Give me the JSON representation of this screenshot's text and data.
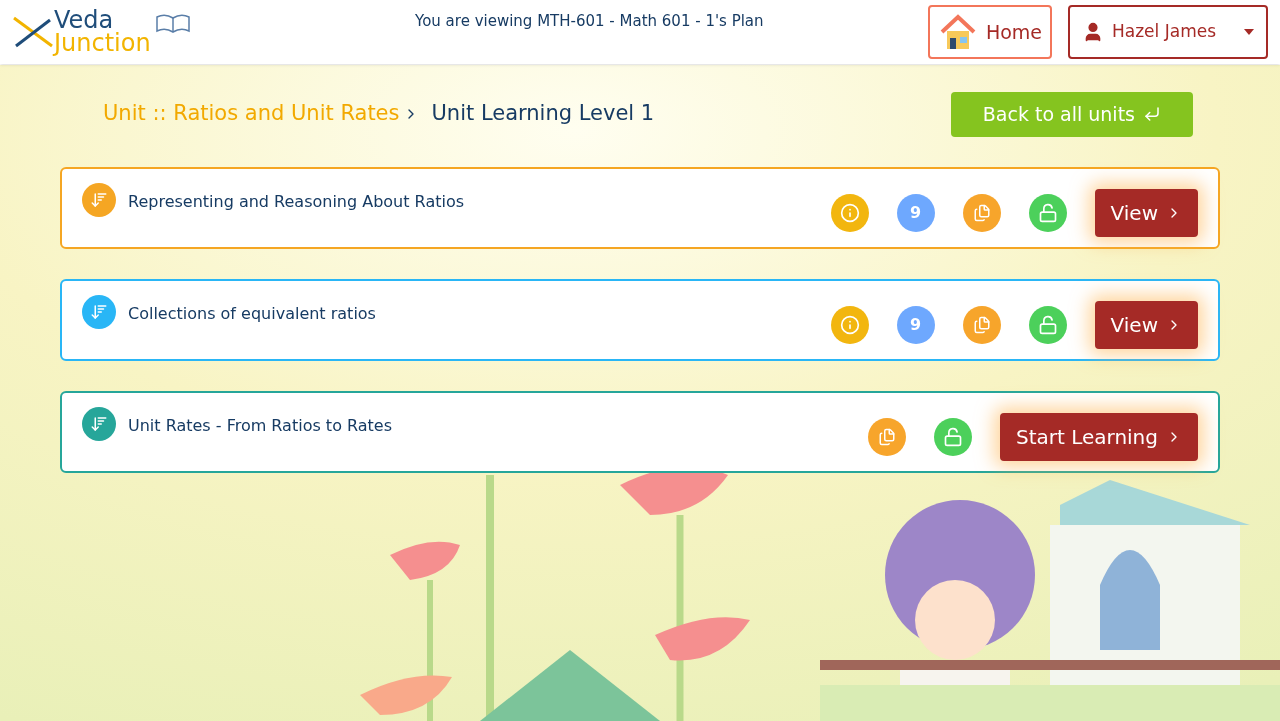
{
  "header": {
    "logo": {
      "line_1": "Veda",
      "line_2": "Junction"
    },
    "viewing_text": "You are viewing MTH-601 - Math 601 - 1's Plan",
    "home_button": "Home",
    "user_menu": "Hazel James"
  },
  "breadcrumb": {
    "unit": "Unit :: Ratios and Unit Rates",
    "current": "Unit Learning Level 1"
  },
  "back_button": "Back to all units",
  "units": [
    {
      "title": "Representing and Reasoning About Ratios",
      "color": "#f5a623",
      "info": true,
      "count": "9",
      "button": "View"
    },
    {
      "title": "Collections of equivalent ratios",
      "color": "#29b6f6",
      "info": true,
      "count": "9",
      "button": "View"
    },
    {
      "title": "Unit Rates - From Ratios to Rates",
      "color": "#26a69a",
      "info": false,
      "button": "Start Learning"
    }
  ]
}
